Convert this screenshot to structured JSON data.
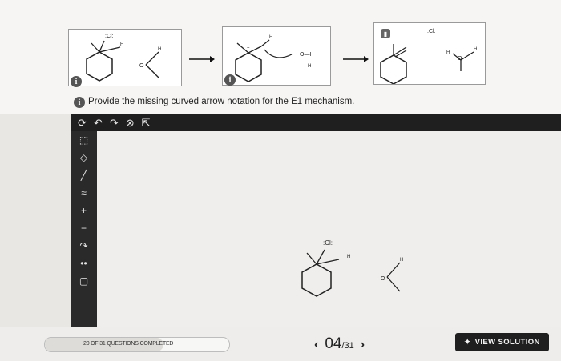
{
  "mechanism": {
    "step1": {
      "cl_label": ":Cl:",
      "h_label": "H",
      "water_o": "O",
      "info_icon": "i"
    },
    "step2": {
      "plus_label": "+",
      "h_label": "H",
      "oh_label": "O—H",
      "h_below": "H",
      "info_icon": "i"
    },
    "step3": {
      "cl_label": ":Cl:",
      "lock_icon": "lock",
      "h_left": "H",
      "o_label": "O",
      "h_right": "H"
    },
    "arrow_icon": "right-arrow"
  },
  "prompt": {
    "info_icon": "i",
    "text": "Provide the missing curved arrow notation for the E1 mechanism."
  },
  "toolbar": {
    "items": [
      "⟳",
      "↶",
      "↷",
      "⊗",
      "⇱"
    ]
  },
  "sidebar": {
    "items": [
      "⬚",
      "◇",
      "╱",
      "≈",
      "+",
      "−",
      "↷",
      "••",
      "▢"
    ]
  },
  "canvas": {
    "cl_label": ":Cl:",
    "h_label": "H",
    "water_o": "O",
    "water_h": "H"
  },
  "footer": {
    "progress_text": "20 OF 31 QUESTIONS COMPLETED",
    "progress_fraction": 0.645,
    "prev_arrow": "‹",
    "current_page": "04",
    "total_pages": "/31",
    "next_arrow": "›",
    "view_solution": "VIEW SOLUTION",
    "view_icon": "✦"
  }
}
